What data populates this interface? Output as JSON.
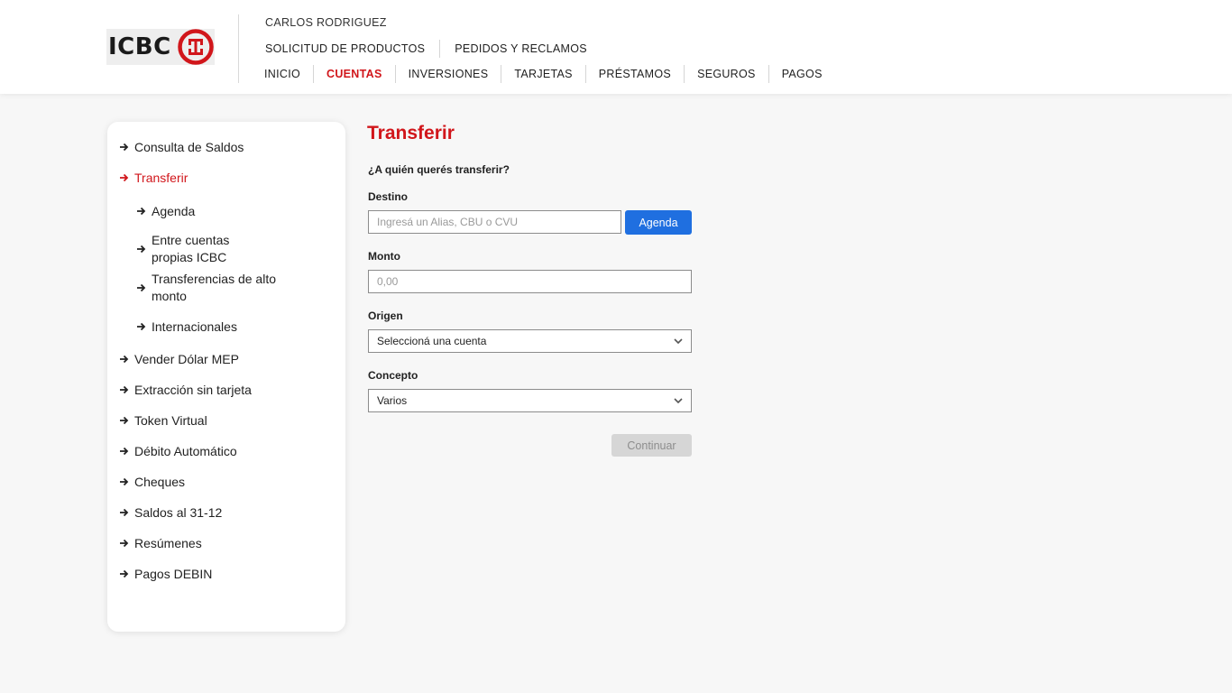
{
  "brand": {
    "logo_text": "ICBC",
    "accent_color": "#d1161b",
    "link_color": "#1f6fe0"
  },
  "header": {
    "username": "CARLOS RODRIGUEZ",
    "top_links": [
      "SOLICITUD DE PRODUCTOS",
      "PEDIDOS Y RECLAMOS"
    ],
    "nav": [
      "INICIO",
      "CUENTAS",
      "INVERSIONES",
      "TARJETAS",
      "PRÉSTAMOS",
      "SEGUROS",
      "PAGOS"
    ],
    "active_nav": "CUENTAS"
  },
  "sidebar": {
    "items": [
      {
        "label": "Consulta de Saldos",
        "icon": "arrow-right-icon"
      },
      {
        "label": "Transferir",
        "icon": "arrow-right-icon",
        "active": true
      },
      {
        "label": "Agenda",
        "icon": "arrow-right-icon",
        "sub": true
      },
      {
        "label": "Entre cuentas propias ICBC",
        "line1": "Entre cuentas",
        "line2": "propias ICBC",
        "icon": "arrow-right-icon",
        "sub": true
      },
      {
        "label": "Transferencias de alto monto",
        "line1": "Transferencias de alto",
        "line2": "monto",
        "icon": "arrow-right-icon",
        "sub": true
      },
      {
        "label": "Internacionales",
        "icon": "arrow-right-icon",
        "sub": true
      },
      {
        "label": "Vender Dólar MEP",
        "icon": "arrow-right-icon"
      },
      {
        "label": "Extracción sin tarjeta",
        "icon": "arrow-right-icon"
      },
      {
        "label": "Token Virtual",
        "icon": "arrow-right-icon"
      },
      {
        "label": "Débito Automático",
        "icon": "arrow-right-icon"
      },
      {
        "label": "Cheques",
        "icon": "arrow-right-icon"
      },
      {
        "label": "Saldos al 31-12",
        "icon": "arrow-right-icon"
      },
      {
        "label": "Resúmenes",
        "icon": "arrow-right-icon"
      },
      {
        "label": "Pagos DEBIN",
        "icon": "arrow-right-icon"
      }
    ]
  },
  "form": {
    "title": "Transferir",
    "question": "¿A quién querés transferir?",
    "destino": {
      "label": "Destino",
      "placeholder": "Ingresá un Alias, CBU o CVU",
      "value": "",
      "button": "Agenda"
    },
    "monto": {
      "label": "Monto",
      "placeholder": "0,00",
      "value": ""
    },
    "origen": {
      "label": "Origen",
      "selected": "Seleccioná una cuenta",
      "icon": "chevron-down-icon"
    },
    "concepto": {
      "label": "Concepto",
      "selected": "Varios",
      "icon": "chevron-down-icon"
    },
    "continue_label": "Continuar"
  }
}
